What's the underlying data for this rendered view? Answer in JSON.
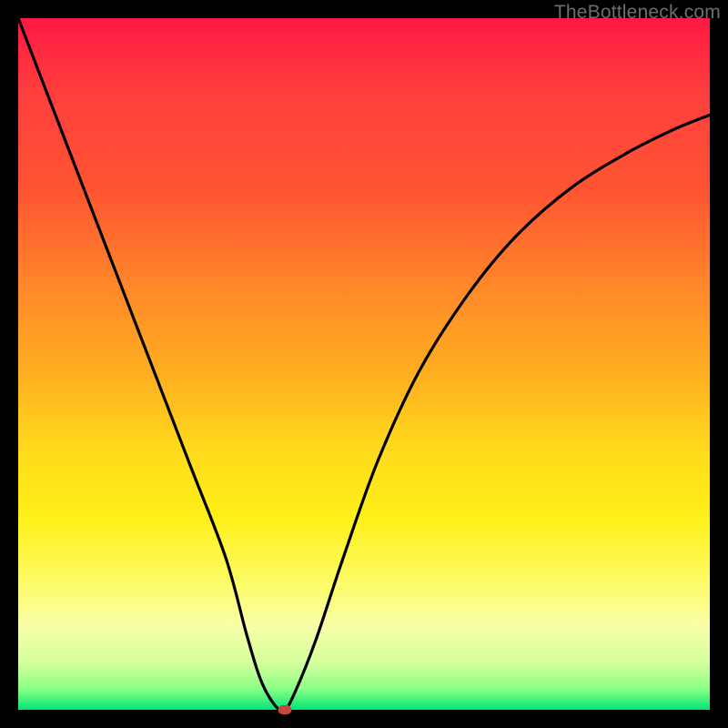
{
  "watermark": "TheBottleneck.com",
  "chart_data": {
    "type": "line",
    "title": "",
    "xlabel": "",
    "ylabel": "",
    "xlim": [
      0,
      100
    ],
    "ylim": [
      0,
      100
    ],
    "grid": false,
    "legend": false,
    "background": "gradient-red-to-green",
    "series": [
      {
        "name": "bottleneck-curve",
        "x": [
          0,
          5,
          10,
          15,
          20,
          25,
          30,
          33,
          35,
          37,
          38.5,
          40,
          43,
          47,
          52,
          58,
          65,
          72,
          80,
          88,
          95,
          100
        ],
        "y": [
          100,
          87,
          74,
          61,
          48,
          35,
          22,
          11,
          4.5,
          0.8,
          0,
          2.5,
          10,
          22,
          36,
          49,
          60,
          68.5,
          75.5,
          80.5,
          84,
          86
        ]
      }
    ],
    "marker": {
      "x": 38.5,
      "y": 0
    }
  }
}
